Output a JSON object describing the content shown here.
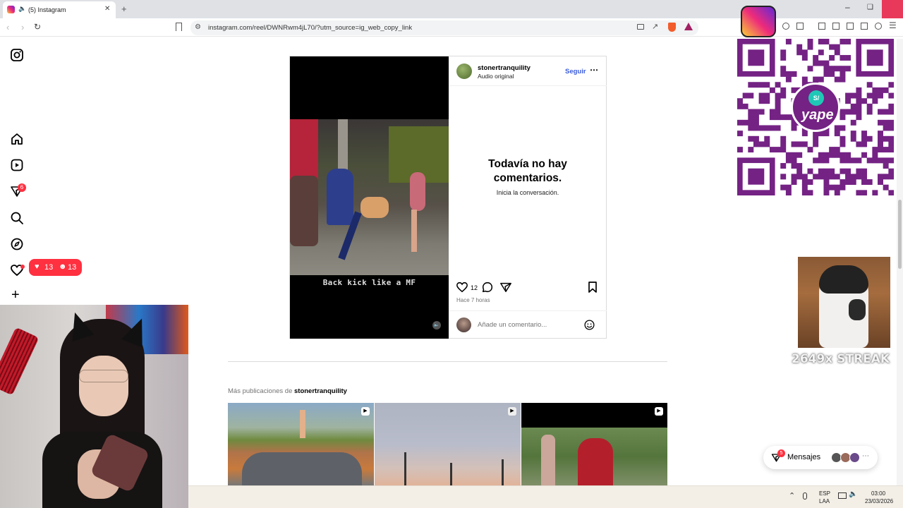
{
  "browser": {
    "tab_title": "(5) Instagram",
    "new_tab_symbol": "+",
    "url": "instagram.com/reel/DWNRwm4jL70/?utm_source=ig_web_copy_link"
  },
  "sidebar": {
    "notifications_badge": "6",
    "likes_count": "13",
    "followers_count": "13",
    "create_symbol": "+"
  },
  "post": {
    "username": "stonertranquility",
    "audio": "Audio original",
    "follow_label": "Seguir",
    "video_caption": "Back kick like a MF",
    "no_comments_title": "Todavía no hay comentarios.",
    "no_comments_sub": "Inicia la conversación.",
    "like_count": "12",
    "time_ago": "Hace 7 horas",
    "comment_placeholder": "Añade un comentario..."
  },
  "more_posts": {
    "prefix": "Más publicaciones de",
    "username": "stonertranquility"
  },
  "overlay": {
    "streak_text": "2649x STREAK",
    "qr_brand": "yape"
  },
  "messages": {
    "label": "Mensajes",
    "badge": "5"
  },
  "taskbar": {
    "lang_top": "ESP",
    "lang_bottom": "LAA",
    "time": "03:00",
    "date": "23/03/2026"
  },
  "colors": {
    "ig_red": "#ff3040",
    "ig_blue": "#0095f6",
    "yape_purple": "#742284",
    "chrome_bg": "#dfe1e5"
  }
}
